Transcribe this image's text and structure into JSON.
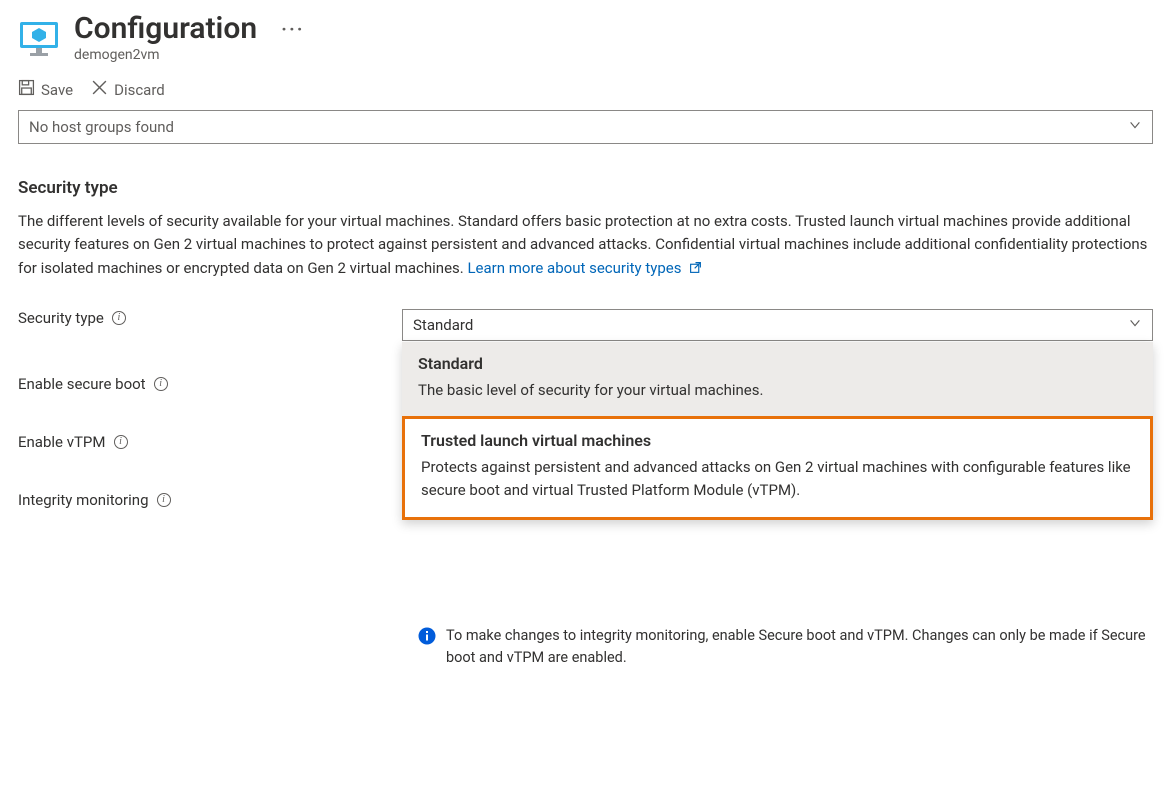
{
  "header": {
    "title": "Configuration",
    "resource_name": "demogen2vm"
  },
  "toolbar": {
    "save_label": "Save",
    "discard_label": "Discard"
  },
  "host_group": {
    "value": "No host groups found"
  },
  "section": {
    "heading": "Security type",
    "description": "The different levels of security available for your virtual machines. Standard offers basic protection at no extra costs. Trusted launch virtual machines provide additional security features on Gen 2 virtual machines to protect against persistent and advanced attacks. Confidential virtual machines include additional confidentiality protections for isolated machines or encrypted data on Gen 2 virtual machines. ",
    "learn_more": "Learn more about security types"
  },
  "form": {
    "security_type_label": "Security type",
    "enable_secure_boot_label": "Enable secure boot",
    "enable_vtpm_label": "Enable vTPM",
    "integrity_monitoring_label": "Integrity monitoring",
    "security_type_value": "Standard"
  },
  "dropdown": {
    "options": [
      {
        "title": "Standard",
        "desc": "The basic level of security for your virtual machines."
      },
      {
        "title": "Trusted launch virtual machines",
        "desc": "Protects against persistent and advanced attacks on Gen 2 virtual machines with configurable features like secure boot and virtual Trusted Platform Module (vTPM)."
      }
    ]
  },
  "info_banner": {
    "text": "To make changes to integrity monitoring, enable Secure boot and vTPM. Changes can only be made if Secure boot and vTPM are enabled."
  }
}
